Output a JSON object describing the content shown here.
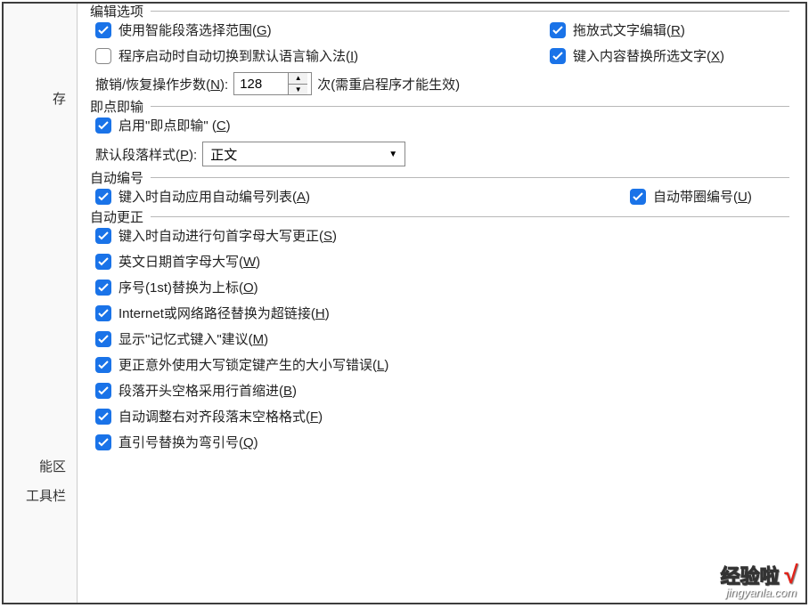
{
  "sidebar": {
    "items": [
      "存",
      "能区",
      "工具栏"
    ]
  },
  "groups": {
    "edit": {
      "legend": "编辑选项",
      "smart_para": {
        "label": "使用智能段落选择范围(",
        "mn": "G",
        "tail": ")",
        "checked": true
      },
      "drag_drop": {
        "label": "拖放式文字编辑(",
        "mn": "R",
        "tail": ")",
        "checked": true
      },
      "switch_ime": {
        "label": "程序启动时自动切换到默认语言输入法(",
        "mn": "I",
        "tail": ")",
        "checked": false
      },
      "replace_sel": {
        "label": "键入内容替换所选文字(",
        "mn": "X",
        "tail": ")",
        "checked": true
      },
      "undo": {
        "label": "撤销/恢复操作步数(",
        "mn": "N",
        "tail": "):",
        "value": "128",
        "suffix": "次(需重启程序才能生效)"
      }
    },
    "click_type": {
      "legend": "即点即输",
      "enable": {
        "label": "启用\"即点即输\" (",
        "mn": "C",
        "tail": ")",
        "checked": true
      },
      "para_style": {
        "label": "默认段落样式(",
        "mn": "P",
        "tail": "):",
        "value": "正文"
      }
    },
    "auto_num": {
      "legend": "自动编号",
      "apply_list": {
        "label": "键入时自动应用自动编号列表(",
        "mn": "A",
        "tail": ")",
        "checked": true
      },
      "circled": {
        "label": "自动带圈编号(",
        "mn": "U",
        "tail": ")",
        "checked": true
      }
    },
    "auto_correct": {
      "legend": "自动更正",
      "cap_sentence": {
        "label": "键入时自动进行句首字母大写更正(",
        "mn": "S",
        "tail": ")",
        "checked": true
      },
      "cap_date": {
        "label": "英文日期首字母大写(",
        "mn": "W",
        "tail": ")",
        "checked": true
      },
      "ordinal": {
        "label": "序号(1st)替换为上标(",
        "mn": "O",
        "tail": ")",
        "checked": true
      },
      "internet": {
        "label": "Internet或网络路径替换为超链接(",
        "mn": "H",
        "tail": ")",
        "checked": true
      },
      "memory": {
        "label": "显示\"记忆式键入\"建议(",
        "mn": "M",
        "tail": ")",
        "checked": true
      },
      "capslock": {
        "label": "更正意外使用大写锁定键产生的大小写错误(",
        "mn": "L",
        "tail": ")",
        "checked": true
      },
      "indent": {
        "label": "段落开头空格采用行首缩进(",
        "mn": "B",
        "tail": ")",
        "checked": true
      },
      "align": {
        "label": "自动调整右对齐段落末空格格式(",
        "mn": "F",
        "tail": ")",
        "checked": true
      },
      "quotes": {
        "label": "直引号替换为弯引号(",
        "mn": "Q",
        "tail": ")",
        "checked": true
      }
    }
  },
  "watermark": {
    "brand": "经验啦",
    "url": "jingyanla.com"
  }
}
